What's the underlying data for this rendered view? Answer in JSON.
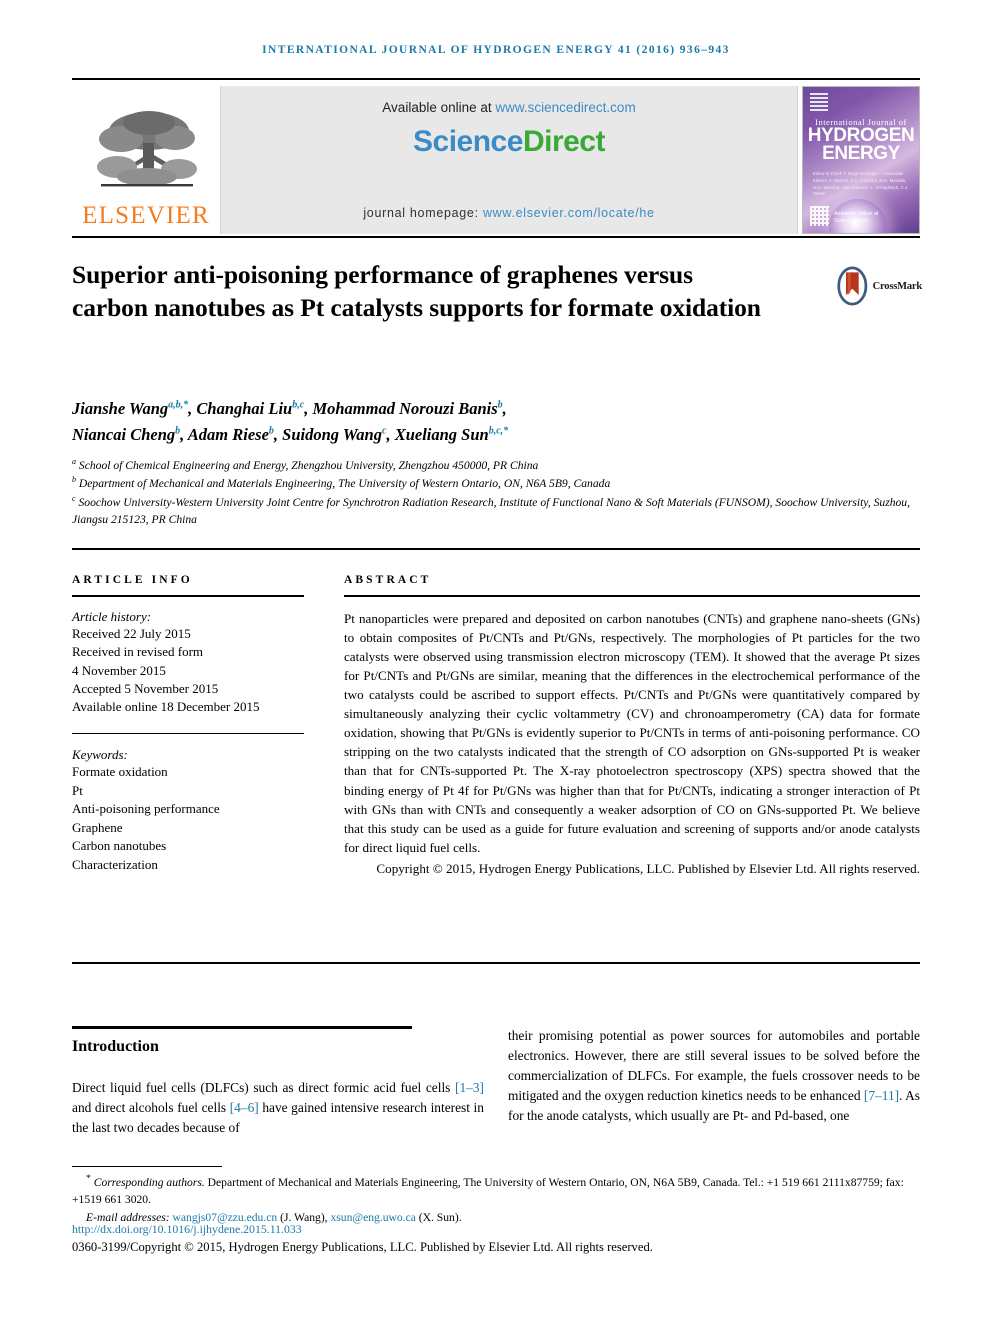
{
  "running_head": "International Journal of Hydrogen Energy 41 (2016) 936–943",
  "masthead": {
    "publisher_name": "ELSEVIER",
    "available_prefix": "Available online at ",
    "available_url": "www.sciencedirect.com",
    "sciencedirect_part1": "Science",
    "sciencedirect_part2": "Direct",
    "homepage_label": "journal homepage: ",
    "homepage_url": "www.elsevier.com/locate/he",
    "cover": {
      "line1": "International Journal of",
      "line2": "HYDROGEN",
      "line3": "ENERGY",
      "editors": "Editor-in-Chief: T. Nejat Veziroglu — Associate Editors: A. Bartels, S.C. Cardona, M.K. Manaila, M.D. Mancha, J.M. Ordonez, L. Schlapbach, C.J. Winter",
      "sciencedirect": "Available online at ScienceDirect"
    }
  },
  "article": {
    "title": "Superior anti-poisoning performance of graphenes versus carbon nanotubes as Pt catalysts supports for formate oxidation",
    "crossmark_label": "CrossMark",
    "authors_line1": [
      {
        "name": "Jianshe Wang",
        "sup": "a,b,*"
      },
      {
        "name": "Changhai Liu",
        "sup": "b,c"
      },
      {
        "name": "Mohammad Norouzi Banis",
        "sup": "b"
      }
    ],
    "authors_line2": [
      {
        "name": "Niancai Cheng",
        "sup": "b"
      },
      {
        "name": "Adam Riese",
        "sup": "b"
      },
      {
        "name": "Suidong Wang",
        "sup": "c"
      },
      {
        "name": "Xueliang Sun",
        "sup": "b,c,*"
      }
    ],
    "affiliations": [
      {
        "marker": "a",
        "text": "School of Chemical Engineering and Energy, Zhengzhou University, Zhengzhou 450000, PR China"
      },
      {
        "marker": "b",
        "text": "Department of Mechanical and Materials Engineering, The University of Western Ontario, ON, N6A 5B9, Canada"
      },
      {
        "marker": "c",
        "text": "Soochow University-Western University Joint Centre for Synchrotron Radiation Research, Institute of Functional Nano & Soft Materials (FUNSOM), Soochow University, Suzhou, Jiangsu 215123, PR China"
      }
    ]
  },
  "article_info": {
    "heading": "ARTICLE INFO",
    "history_label": "Article history:",
    "history": [
      "Received 22 July 2015",
      "Received in revised form",
      "4 November 2015",
      "Accepted 5 November 2015",
      "Available online 18 December 2015"
    ],
    "keywords_label": "Keywords:",
    "keywords": [
      "Formate oxidation",
      "Pt",
      "Anti-poisoning performance",
      "Graphene",
      "Carbon nanotubes",
      "Characterization"
    ]
  },
  "abstract": {
    "heading": "ABSTRACT",
    "text": "Pt nanoparticles were prepared and deposited on carbon nanotubes (CNTs) and graphene nano-sheets (GNs) to obtain composites of Pt/CNTs and Pt/GNs, respectively. The morphologies of Pt particles for the two catalysts were observed using transmission electron microscopy (TEM). It showed that the average Pt sizes for Pt/CNTs and Pt/GNs are similar, meaning that the differences in the electrochemical performance of the two catalysts could be ascribed to support effects. Pt/CNTs and Pt/GNs were quantitatively compared by simultaneously analyzing their cyclic voltammetry (CV) and chronoamperometry (CA) data for formate oxidation, showing that Pt/GNs is evidently superior to Pt/CNTs in terms of anti-poisoning performance. CO stripping on the two catalysts indicated that the strength of CO adsorption on GNs-supported Pt is weaker than that for CNTs-supported Pt. The X-ray photoelectron spectroscopy (XPS) spectra showed that the binding energy of Pt 4f for Pt/GNs was higher than that for Pt/CNTs, indicating a stronger interaction of Pt with GNs than with CNTs and consequently a weaker adsorption of CO on GNs-supported Pt. We believe that this study can be used as a guide for future evaluation and screening of supports and/or anode catalysts for direct liquid fuel cells.",
    "copyright": "Copyright © 2015, Hydrogen Energy Publications, LLC. Published by Elsevier Ltd. All rights reserved."
  },
  "body": {
    "intro_heading": "Introduction",
    "left_pre1": "Direct liquid fuel cells (DLFCs) such as direct formic acid fuel cells ",
    "left_cite1": "[1–3]",
    "left_mid1": " and direct alcohols fuel cells ",
    "left_cite2": "[4–6]",
    "left_post1": " have gained intensive research interest in the last two decades because of",
    "right_pre1": "their promising potential as power sources for automobiles and portable electronics. However, there are still several issues to be solved before the commercialization of DLFCs. For example, the fuels crossover needs to be mitigated and the oxygen reduction kinetics needs to be enhanced ",
    "right_cite1": "[7–11]",
    "right_post1": ". As for the anode catalysts, which usually are Pt- and Pd-based, one"
  },
  "footer": {
    "corresponding_marker": "*",
    "corresponding_label": "Corresponding authors.",
    "corresponding_text": " Department of Mechanical and Materials Engineering, The University of Western Ontario, ON, N6A 5B9, Canada. Tel.: +1 519 661 2111x87759; fax: +1519 661 3020.",
    "email_label": "E-mail addresses: ",
    "email1": "wangjs07@zzu.edu.cn",
    "email1_owner": " (J. Wang), ",
    "email2": "xsun@eng.uwo.ca",
    "email2_owner": " (X. Sun).",
    "doi": "http://dx.doi.org/10.1016/j.ijhydene.2015.11.033",
    "issn": "0360-3199/Copyright © 2015, Hydrogen Energy Publications, LLC. Published by Elsevier Ltd. All rights reserved."
  },
  "colors": {
    "link_blue": "#1a7aa8",
    "sciencedirect_green": "#3aa935",
    "sciencedirect_blue": "#3b8bc4",
    "elsevier_orange": "#F47C20"
  }
}
